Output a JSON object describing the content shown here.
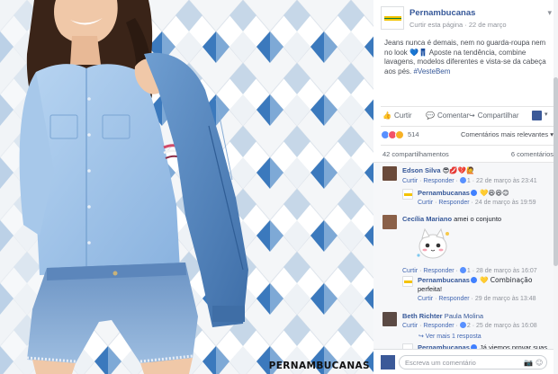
{
  "photo": {
    "brand_watermark": "PERNAMBUCANAS",
    "tile_colors": [
      "#f3f5f7",
      "#c9d8e6",
      "#6f9fd0",
      "#2e6fb5",
      "#ffffff"
    ]
  },
  "post": {
    "page_name": "Pernambucanas",
    "like_page": "Curtir esta página",
    "separator": " · ",
    "date": "22 de março",
    "menu_icon": "globe-icon",
    "text_line1": "Jeans nunca é demais, nem no guarda-roupa nem",
    "text_line2": "no look",
    "text_emoji1": "💙",
    "text_emoji2": "👖",
    "text_line2b": " Aposte na tendência, combine",
    "text_line3": "lavagens, modelos diferentes e vista-se da cabeça",
    "text_line4": "aos pés.",
    "hashtag": "#VesteBem"
  },
  "actions": {
    "like": "Curtir",
    "comment": "Comentar",
    "share": "Compartilhar",
    "like_icon": "👍",
    "comment_icon": "💬",
    "share_icon": "↪"
  },
  "reactions": {
    "count": "514",
    "relevance": "Comentários mais relevantes ▾"
  },
  "stats": {
    "shares": "42 compartilhamentos",
    "comments": "6 comentários"
  },
  "comments": [
    {
      "name": "Edson Silva",
      "text": "😎💋💔🙋",
      "like": "Curtir",
      "reply": "Responder",
      "likes": "1",
      "time": "22 de março às 23:41"
    },
    {
      "name": "Pernambucanas",
      "text": "💛😆😆😊",
      "like": "Curtir",
      "reply": "Responder",
      "time": "24 de março às 19:59"
    },
    {
      "name": "Cecília Mariano",
      "text": "amei o conjunto",
      "like": "Curtir",
      "reply": "Responder",
      "likes": "1",
      "time": "28 de março às 16:07"
    },
    {
      "name": "Pernambucanas",
      "text_a": "💛 Combinação",
      "text_b": "perfeita!",
      "like": "Curtir",
      "reply": "Responder",
      "time": "29 de março às 13:48"
    },
    {
      "name": "Beth Richter",
      "text": "Paula Molina",
      "like": "Curtir",
      "reply": "Responder",
      "likes": "2",
      "time": "25 de março às 16:08"
    }
  ],
  "view_more": "↪ Ver mais 1 resposta",
  "partial_reply": {
    "name": "Pernambucanas",
    "text": "Já viemos provar suas"
  },
  "write_comment": {
    "placeholder": "Escreva um comentário",
    "camera_icon": "📷",
    "emoji_icon": "☺"
  },
  "colors": {
    "link": "#365899",
    "brand_yellow": "#f4c300",
    "brand_green": "#0b7d3b",
    "denim_light": "#9ec3ea",
    "denim_dark": "#4f7fb4"
  }
}
